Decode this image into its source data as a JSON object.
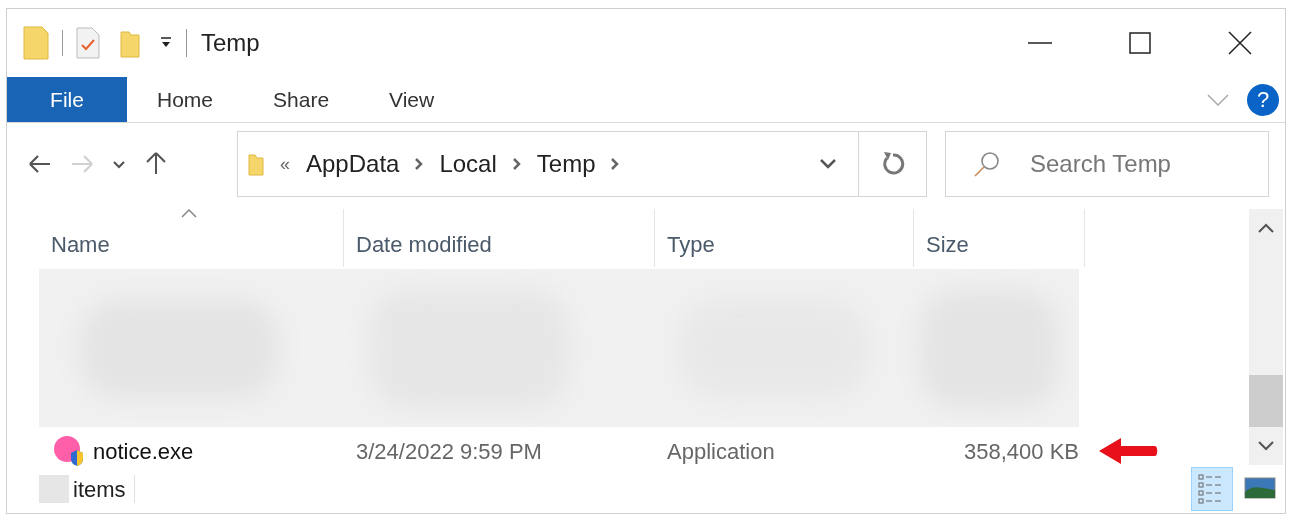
{
  "window": {
    "title": "Temp"
  },
  "ribbon": {
    "tabs": [
      {
        "label": "File",
        "selected": true
      },
      {
        "label": "Home",
        "selected": false
      },
      {
        "label": "Share",
        "selected": false
      },
      {
        "label": "View",
        "selected": false
      }
    ]
  },
  "help": {
    "label": "?"
  },
  "navigation": [
    {
      "kind": "back",
      "disabled": false
    },
    {
      "kind": "forward",
      "disabled": true
    },
    {
      "kind": "recent",
      "disabled": false
    },
    {
      "kind": "up",
      "disabled": false
    }
  ],
  "address": {
    "overflow": "«",
    "path": [
      "AppData",
      "Local",
      "Temp"
    ]
  },
  "search": {
    "placeholder": "Search Temp"
  },
  "table": {
    "columns": [
      {
        "label": "Name",
        "sorted": true
      },
      {
        "label": "Date modified",
        "sorted": false
      },
      {
        "label": "Type",
        "sorted": false
      },
      {
        "label": "Size",
        "sorted": false
      }
    ],
    "rows": [
      {
        "name": "notice.exe",
        "date_modified": "3/24/2022 9:59 PM",
        "type": "Application",
        "size": "358,400 KB",
        "highlighted": true
      }
    ]
  },
  "status_bar": {
    "label": "items"
  },
  "view_buttons": [
    {
      "kind": "details",
      "selected": true
    },
    {
      "kind": "large-icons",
      "selected": false
    }
  ]
}
